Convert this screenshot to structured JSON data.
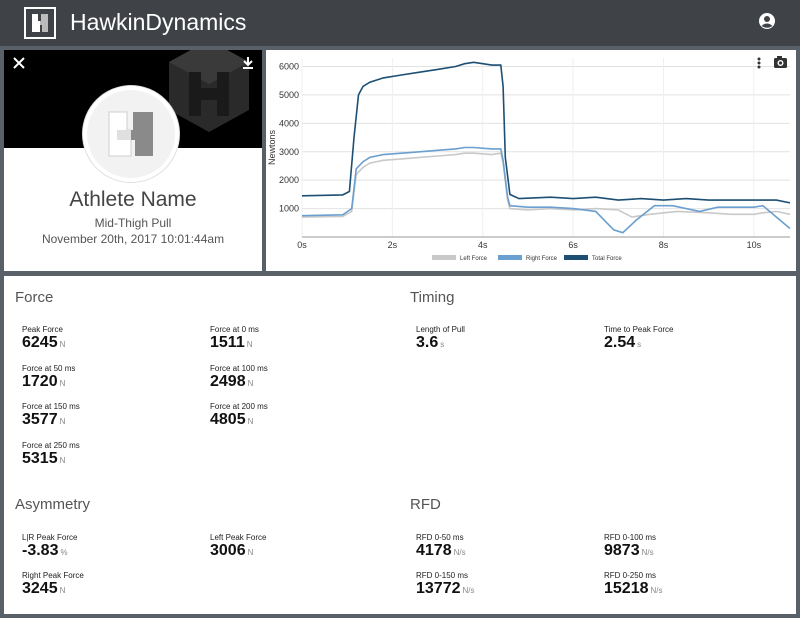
{
  "app": {
    "title_bold": "Hawkin",
    "title_thin": "Dynamics"
  },
  "athlete": {
    "name": "Athlete Name",
    "test_type": "Mid-Thigh Pull",
    "date": "November 20th, 2017 10:01:44am"
  },
  "chart_data": {
    "type": "line",
    "ylabel": "Newtons",
    "xlabel": "",
    "x_unit": "s",
    "ylim": [
      0,
      6300
    ],
    "xlim": [
      0,
      10.8
    ],
    "yticks": [
      1000,
      2000,
      3000,
      4000,
      5000,
      6000
    ],
    "xticks": [
      0,
      2,
      4,
      6,
      8,
      10
    ],
    "xtick_labels": [
      "0s",
      "2s",
      "4s",
      "6s",
      "8s",
      "10s"
    ],
    "legend_position": "bottom",
    "series": [
      {
        "name": "Left Force",
        "color": "#c9c9c9",
        "points": [
          [
            0,
            700
          ],
          [
            0.9,
            720
          ],
          [
            1.1,
            900
          ],
          [
            1.2,
            2200
          ],
          [
            1.35,
            2450
          ],
          [
            1.5,
            2600
          ],
          [
            1.8,
            2700
          ],
          [
            2.2,
            2750
          ],
          [
            2.6,
            2800
          ],
          [
            3,
            2850
          ],
          [
            3.4,
            2900
          ],
          [
            3.6,
            2950
          ],
          [
            3.8,
            2950
          ],
          [
            4.2,
            2900
          ],
          [
            4.4,
            2950
          ],
          [
            4.45,
            2600
          ],
          [
            4.55,
            1300
          ],
          [
            4.6,
            1000
          ],
          [
            5,
            950
          ],
          [
            5.5,
            1000
          ],
          [
            6,
            950
          ],
          [
            6.5,
            1000
          ],
          [
            7,
            950
          ],
          [
            7.3,
            700
          ],
          [
            7.7,
            800
          ],
          [
            8.3,
            900
          ],
          [
            9,
            850
          ],
          [
            9.5,
            800
          ],
          [
            10,
            800
          ],
          [
            10.2,
            850
          ],
          [
            10.5,
            900
          ],
          [
            10.8,
            800
          ]
        ]
      },
      {
        "name": "Right Force",
        "color": "#6a9fcf",
        "points": [
          [
            0,
            750
          ],
          [
            0.9,
            780
          ],
          [
            1.1,
            1000
          ],
          [
            1.2,
            2400
          ],
          [
            1.35,
            2650
          ],
          [
            1.5,
            2800
          ],
          [
            1.8,
            2900
          ],
          [
            2.2,
            2950
          ],
          [
            2.6,
            3000
          ],
          [
            3,
            3050
          ],
          [
            3.4,
            3100
          ],
          [
            3.6,
            3150
          ],
          [
            3.8,
            3150
          ],
          [
            4.2,
            3100
          ],
          [
            4.4,
            3100
          ],
          [
            4.45,
            2700
          ],
          [
            4.55,
            1400
          ],
          [
            4.6,
            1100
          ],
          [
            5,
            1050
          ],
          [
            5.5,
            1050
          ],
          [
            6,
            1000
          ],
          [
            6.5,
            900
          ],
          [
            6.9,
            250
          ],
          [
            7.1,
            150
          ],
          [
            7.4,
            600
          ],
          [
            7.8,
            1100
          ],
          [
            8.2,
            1100
          ],
          [
            8.8,
            900
          ],
          [
            9.2,
            1050
          ],
          [
            9.7,
            1050
          ],
          [
            10,
            1050
          ],
          [
            10.2,
            1100
          ],
          [
            10.5,
            700
          ],
          [
            10.8,
            300
          ]
        ]
      },
      {
        "name": "Total Force",
        "color": "#1c4f73",
        "points": [
          [
            0,
            1450
          ],
          [
            0.9,
            1480
          ],
          [
            1.05,
            1600
          ],
          [
            1.15,
            3500
          ],
          [
            1.25,
            5000
          ],
          [
            1.35,
            5300
          ],
          [
            1.5,
            5450
          ],
          [
            1.8,
            5600
          ],
          [
            2.2,
            5700
          ],
          [
            2.6,
            5800
          ],
          [
            3,
            5900
          ],
          [
            3.4,
            6000
          ],
          [
            3.6,
            6100
          ],
          [
            3.8,
            6150
          ],
          [
            4.2,
            6050
          ],
          [
            4.4,
            6050
          ],
          [
            4.45,
            5300
          ],
          [
            4.5,
            2800
          ],
          [
            4.6,
            1500
          ],
          [
            4.8,
            1350
          ],
          [
            5.5,
            1400
          ],
          [
            6,
            1350
          ],
          [
            6.5,
            1400
          ],
          [
            7,
            1300
          ],
          [
            7.5,
            1350
          ],
          [
            8,
            1300
          ],
          [
            8.5,
            1350
          ],
          [
            9,
            1300
          ],
          [
            9.5,
            1300
          ],
          [
            10,
            1300
          ],
          [
            10.5,
            1300
          ],
          [
            10.8,
            1200
          ]
        ]
      }
    ]
  },
  "force": {
    "title": "Force",
    "items": [
      {
        "label": "Peak Force",
        "value": "6245",
        "unit": "N"
      },
      {
        "label": "Force at 0 ms",
        "value": "1511",
        "unit": "N"
      },
      {
        "label": "Force at 50 ms",
        "value": "1720",
        "unit": "N"
      },
      {
        "label": "Force at 100 ms",
        "value": "2498",
        "unit": "N"
      },
      {
        "label": "Force at 150 ms",
        "value": "3577",
        "unit": "N"
      },
      {
        "label": "Force at 200 ms",
        "value": "4805",
        "unit": "N"
      },
      {
        "label": "Force at 250 ms",
        "value": "5315",
        "unit": "N"
      }
    ]
  },
  "timing": {
    "title": "Timing",
    "items": [
      {
        "label": "Length of Pull",
        "value": "3.6",
        "unit": "s"
      },
      {
        "label": "Time to Peak Force",
        "value": "2.54",
        "unit": "s"
      }
    ]
  },
  "asymmetry": {
    "title": "Asymmetry",
    "items": [
      {
        "label": "L|R Peak Force",
        "value": "-3.83",
        "unit": "%"
      },
      {
        "label": "Left Peak Force",
        "value": "3006",
        "unit": "N"
      },
      {
        "label": "Right Peak Force",
        "value": "3245",
        "unit": "N"
      }
    ]
  },
  "rfd": {
    "title": "RFD",
    "items": [
      {
        "label": "RFD 0-50 ms",
        "value": "4178",
        "unit": "N/s"
      },
      {
        "label": "RFD 0-100 ms",
        "value": "9873",
        "unit": "N/s"
      },
      {
        "label": "RFD 0-150 ms",
        "value": "13772",
        "unit": "N/s"
      },
      {
        "label": "RFD 0-250 ms",
        "value": "15218",
        "unit": "N/s"
      }
    ]
  },
  "colors": {
    "topbar": "#3f4247",
    "background": "#5a6068"
  }
}
